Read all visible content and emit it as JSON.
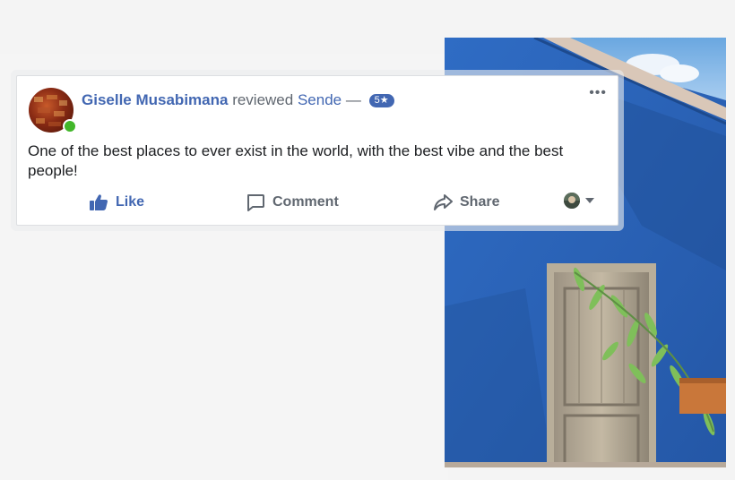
{
  "review": {
    "author": "Giselle Musabimana",
    "verb": "reviewed",
    "page": "Sende",
    "separator": "—",
    "rating": "5★",
    "text": "One of the best places to ever exist in the world, with the best vibe and the best people!"
  },
  "actions": {
    "like": "Like",
    "comment": "Comment",
    "share": "Share"
  },
  "more_icon": "more-options-icon",
  "colors": {
    "link_blue": "#4267b2",
    "text_grey": "#606770",
    "online_green": "#42b72a",
    "wall_blue": "#2a63b8"
  }
}
